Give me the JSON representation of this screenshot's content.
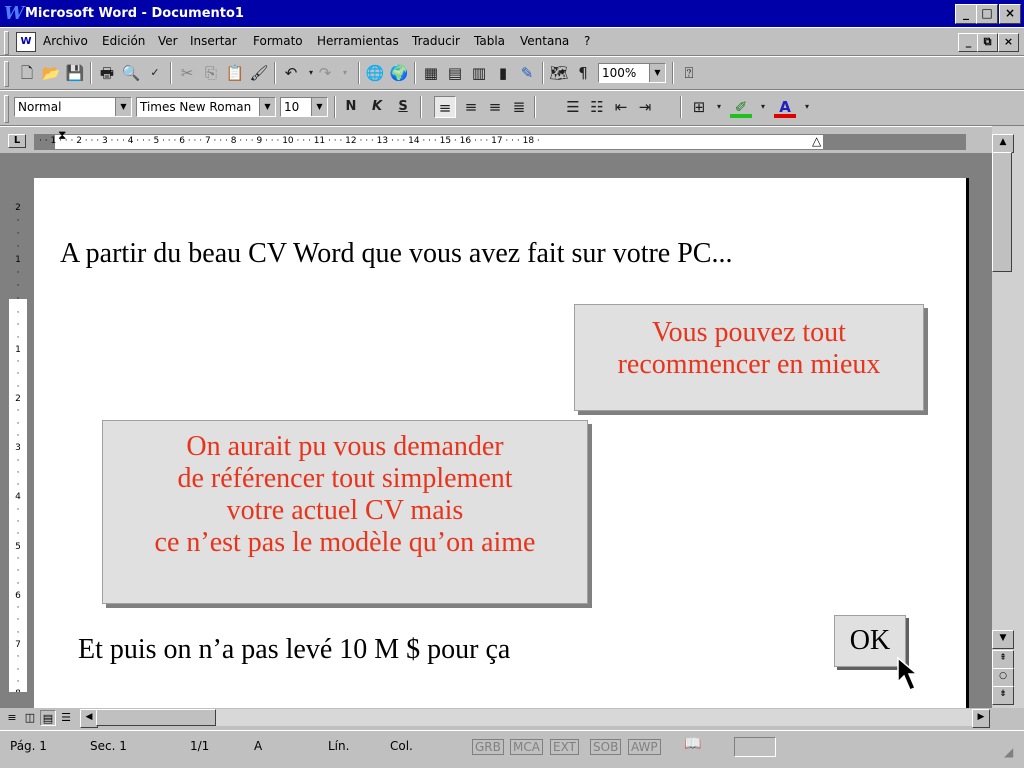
{
  "window": {
    "title": "Microsoft Word - Documento1",
    "app_icon_letter": "W"
  },
  "window_controls": {
    "minimize": "_",
    "maximize": "□",
    "close": "×"
  },
  "menu": {
    "items": [
      "Archivo",
      "Edición",
      "Ver",
      "Insertar",
      "Formato",
      "Herramientas",
      "Traducir",
      "Tabla",
      "Ventana",
      "?"
    ],
    "doc_controls": {
      "minimize": "_",
      "restore": "⧉",
      "close": "×"
    }
  },
  "standard_toolbar": {
    "zoom": "100%"
  },
  "format_toolbar": {
    "style": "Normal",
    "font": "Times New Roman",
    "size": "10",
    "bold": "N",
    "italic": "K",
    "underline": "S"
  },
  "ruler": {
    "marks": "· · 1 · · · 2 · · · 3 · · · 4 · · · 5 · · · 6 · · · 7 · · · 8 · · · 9 · · · 10 · · · 11 · · · 12 · · · 13 · · · 14 · · · 15 ·  16 · · · 17 · · · 18 ·"
  },
  "document": {
    "line1": "A partir du beau CV Word que vous avez fait sur votre PC...",
    "callout_right": [
      "Vous pouvez tout",
      "recommencer en mieux"
    ],
    "callout_left": [
      "On aurait pu vous demander",
      "de référencer tout simplement",
      "votre actuel CV mais",
      "ce n’est pas le modèle qu’on aime"
    ],
    "line_bottom": "Et puis on n’a pas levé 10 M $ pour ça",
    "ok_button": "OK"
  },
  "status_bar": {
    "page": "Pág. 1",
    "section": "Sec. 1",
    "pages": "1/1",
    "at": "A",
    "line": "Lín.",
    "col": "Col.",
    "modes": [
      "GRB",
      "MCA",
      "EXT",
      "SOB",
      "AWP"
    ]
  },
  "colors": {
    "titlebar": "#0000a8",
    "callout_text": "#e8341c",
    "callout_bg": "#e0e0e0"
  }
}
